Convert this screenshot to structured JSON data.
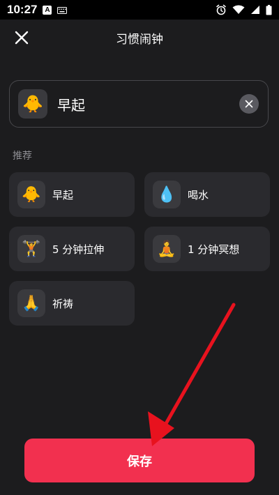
{
  "status_bar": {
    "time": "10:27",
    "app_badge": "A",
    "icons": [
      "keyboard-icon",
      "alarm-icon",
      "wifi-icon",
      "signal-icon",
      "battery-icon"
    ]
  },
  "header": {
    "title": "习惯闹钟",
    "close_icon": "close-icon"
  },
  "habit_name_field": {
    "emoji": "🐥",
    "value": "早起",
    "clear_icon": "clear-icon"
  },
  "recommendations": {
    "label": "推荐",
    "items": [
      {
        "emoji": "🐥",
        "label": "早起"
      },
      {
        "emoji": "💧",
        "label": "喝水"
      },
      {
        "emoji": "🏋️",
        "label": "5 分钟拉伸"
      },
      {
        "emoji": "🧘",
        "label": "1 分钟冥想"
      },
      {
        "emoji": "🙏",
        "label": "祈祷"
      }
    ]
  },
  "save_button": {
    "label": "保存"
  },
  "colors": {
    "background": "#1c1c1e",
    "card": "#2a2a2e",
    "accent": "#f2304f",
    "annotation_arrow": "#e8121e"
  }
}
